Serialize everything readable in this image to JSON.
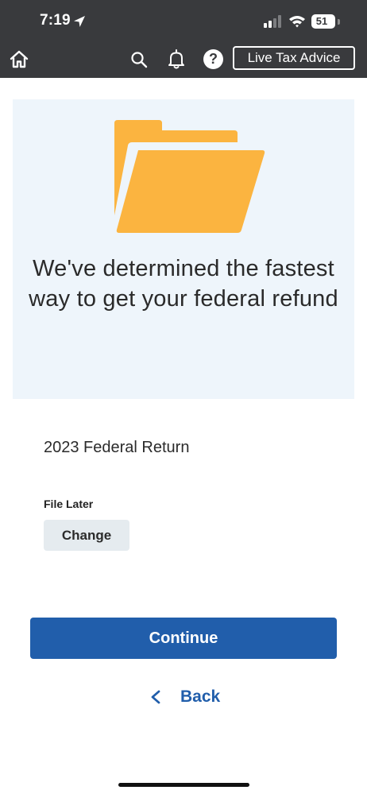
{
  "status_bar": {
    "time": "7:19",
    "battery": "51",
    "icons": [
      "location-arrow-icon",
      "cellular-signal-icon",
      "wifi-icon",
      "battery-icon"
    ]
  },
  "nav": {
    "icons": [
      "home-icon",
      "search-icon",
      "bell-icon",
      "help-icon"
    ],
    "help_glyph": "?",
    "live_advice_label": "Live Tax Advice"
  },
  "hero": {
    "icon": "folder-icon",
    "heading": "We've determined the fastest way to get your federal refund",
    "background": "#eef5fb",
    "folder_color": "#fbb440"
  },
  "return_section": {
    "title": "2023 Federal Return",
    "filing_status": "File Later",
    "change_label": "Change"
  },
  "actions": {
    "continue_label": "Continue",
    "back_label": "Back"
  },
  "colors": {
    "header": "#393a3d",
    "primary": "#215eab"
  }
}
